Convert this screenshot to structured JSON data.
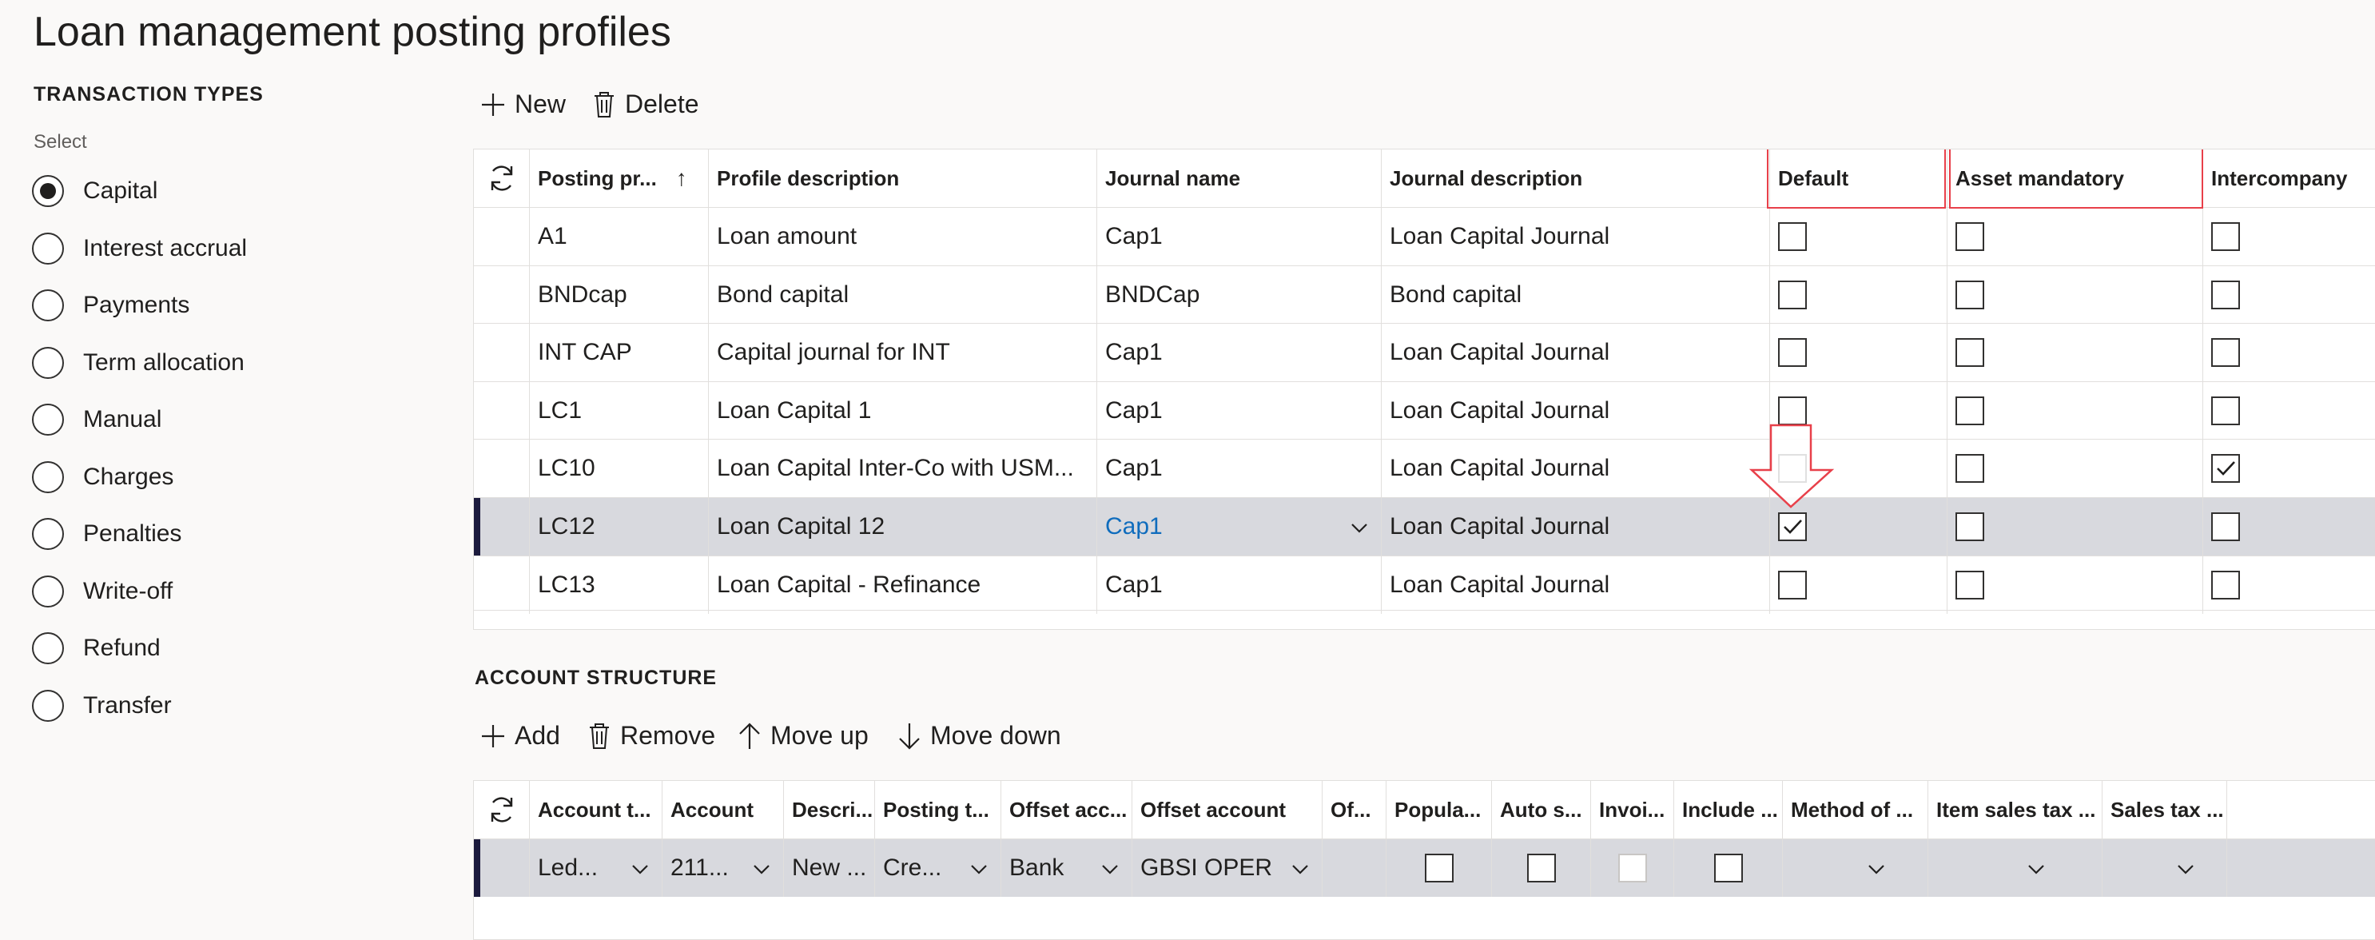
{
  "page": {
    "title": "Loan management posting profiles"
  },
  "transaction_types": {
    "heading": "TRANSACTION TYPES",
    "select_label": "Select",
    "selected": "Capital",
    "options": [
      "Capital",
      "Interest accrual",
      "Payments",
      "Term allocation",
      "Manual",
      "Charges",
      "Penalties",
      "Write-off",
      "Refund",
      "Transfer"
    ]
  },
  "toolbar": {
    "new_label": "New",
    "delete_label": "Delete"
  },
  "profiles_grid": {
    "columns": [
      "Posting pr...",
      "Profile description",
      "Journal name",
      "Journal description",
      "Default",
      "Asset mandatory",
      "Intercompany"
    ],
    "sort_indicator": "↑",
    "rows": [
      {
        "code": "A1",
        "desc": "Loan amount",
        "journal": "Cap1",
        "journal_desc": "Loan Capital Journal",
        "default": false,
        "asset": false,
        "interco": false
      },
      {
        "code": "BNDcap",
        "desc": "Bond capital",
        "journal": "BNDCap",
        "journal_desc": "Bond capital",
        "default": false,
        "asset": false,
        "interco": false
      },
      {
        "code": "INT CAP",
        "desc": "Capital journal for INT",
        "journal": "Cap1",
        "journal_desc": "Loan Capital Journal",
        "default": false,
        "asset": false,
        "interco": false
      },
      {
        "code": "LC1",
        "desc": "Loan Capital 1",
        "journal": "Cap1",
        "journal_desc": "Loan Capital Journal",
        "default": false,
        "asset": false,
        "interco": false
      },
      {
        "code": "LC10",
        "desc": "Loan Capital Inter-Co with USM...",
        "journal": "Cap1",
        "journal_desc": "Loan Capital Journal",
        "default": false,
        "asset": false,
        "interco": true
      },
      {
        "code": "LC12",
        "desc": "Loan Capital 12",
        "journal": "Cap1",
        "journal_desc": "Loan Capital Journal",
        "default": true,
        "asset": false,
        "interco": false,
        "selected": true
      },
      {
        "code": "LC13",
        "desc": "Loan Capital - Refinance",
        "journal": "Cap1",
        "journal_desc": "Loan Capital Journal",
        "default": false,
        "asset": false,
        "interco": false
      }
    ]
  },
  "account_structure": {
    "heading": "ACCOUNT STRUCTURE",
    "toolbar": {
      "add_label": "Add",
      "remove_label": "Remove",
      "move_up_label": "Move up",
      "move_down_label": "Move down"
    },
    "columns": [
      "Account t...",
      "Account",
      "Descri...",
      "Posting t...",
      "Offset acc...",
      "Offset account",
      "Of...",
      "Popula...",
      "Auto s...",
      "Invoi...",
      "Include ...",
      "Method of ...",
      "Item sales tax ...",
      "Sales tax ..."
    ],
    "row": {
      "account_type": "Led...",
      "account": "211...",
      "description": "New ...",
      "posting_type": "Cre...",
      "offset_account_type": "Bank",
      "offset_account": "GBSI OPER"
    }
  },
  "colors": {
    "accent": "#201f1e",
    "link": "#0f6cbd",
    "annotation_red": "#e8404a",
    "selected_row": "#d8d9de"
  }
}
